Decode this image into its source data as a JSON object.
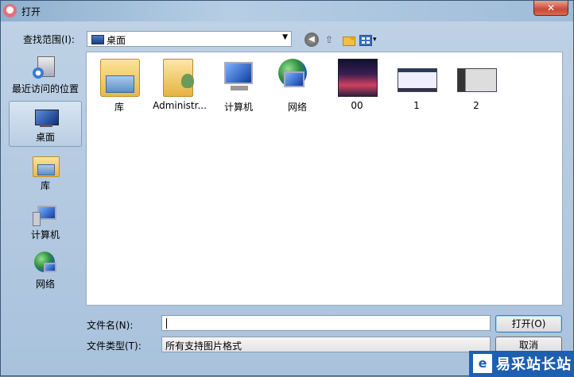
{
  "window": {
    "title": "打开",
    "close_glyph": "✕"
  },
  "toolbar": {
    "lookin_label": "查找范围(I):",
    "lookin_value": "桌面",
    "dropdown_arrow": "▼",
    "back_glyph": "◀",
    "up_glyph": "⇧",
    "new_folder_glyph": "✦",
    "view_arrow": "▾"
  },
  "places": [
    {
      "label": "最近访问的位置",
      "icon": "recent-places-icon"
    },
    {
      "label": "桌面",
      "icon": "desktop-icon",
      "selected": true
    },
    {
      "label": "库",
      "icon": "library-icon"
    },
    {
      "label": "计算机",
      "icon": "computer-icon"
    },
    {
      "label": "网络",
      "icon": "network-icon"
    }
  ],
  "items": [
    {
      "label": "库",
      "icon": "library-folder-icon"
    },
    {
      "label": "Administr...",
      "icon": "user-folder-icon"
    },
    {
      "label": "计算机",
      "icon": "computer-icon"
    },
    {
      "label": "网络",
      "icon": "network-icon"
    },
    {
      "label": "00",
      "icon": "image-thumbnail-icon"
    },
    {
      "label": "1",
      "icon": "image-thumbnail-icon"
    },
    {
      "label": "2",
      "icon": "image-thumbnail-icon"
    }
  ],
  "bottom": {
    "filename_label": "文件名(N):",
    "filename_value": "",
    "filetype_label": "文件类型(T):",
    "filetype_value": "所有支持图片格式",
    "open_button": "打开(O)",
    "cancel_button": "取消"
  },
  "watermark": {
    "text": "易采站长站",
    "logo": "e"
  }
}
